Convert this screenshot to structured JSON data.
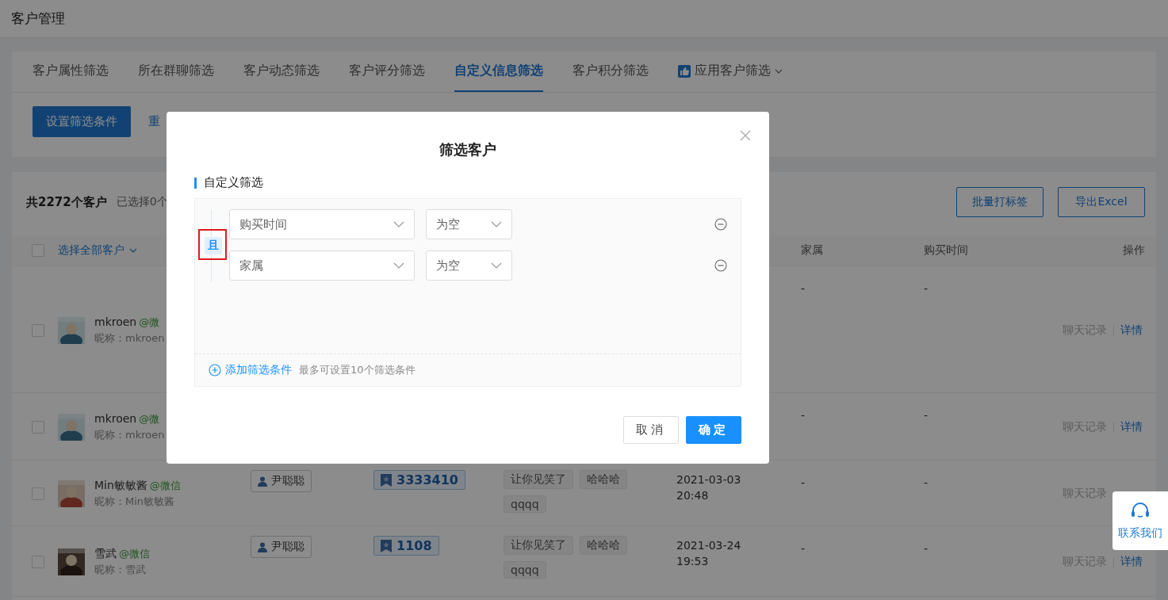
{
  "page": {
    "title": "客户管理"
  },
  "filter_tabs": [
    {
      "label": "客户属性筛选",
      "selected": false,
      "kind": "plain"
    },
    {
      "label": "所在群聊筛选",
      "selected": false,
      "kind": "plain"
    },
    {
      "label": "客户动态筛选",
      "selected": false,
      "kind": "plain"
    },
    {
      "label": "客户评分筛选",
      "selected": false,
      "kind": "plain"
    },
    {
      "label": "自定义信息筛选",
      "selected": true,
      "kind": "plain"
    },
    {
      "label": "客户积分筛选",
      "selected": false,
      "kind": "plain"
    },
    {
      "label": "应用客户筛选",
      "selected": false,
      "kind": "app"
    }
  ],
  "filter_actions": {
    "primary": "设置筛选条件",
    "link": "重"
  },
  "customers": {
    "summary": "共2272个客户",
    "selection": "已选择0个",
    "buttons": [
      "批量打标签",
      "导出Excel"
    ],
    "header": {
      "checked": false,
      "select_all": "选择全部客户",
      "family": "家属",
      "purchase_time": "购买时间",
      "actions": "操作"
    },
    "rows": [
      {
        "checked": false,
        "name": "mkroen",
        "source": "@微",
        "nickname": "昵称：mkroen",
        "family": "-",
        "purchase_time": "-",
        "actions": [
          "聊天记录",
          "详情"
        ]
      },
      {
        "checked": false,
        "name": "mkroen",
        "source": "@微",
        "nickname": "昵称：mkroen",
        "family": "-",
        "purchase_time": "-",
        "actions": [
          "聊天记录",
          "详情"
        ]
      },
      {
        "checked": false,
        "name": "Min敏敏酱",
        "source": "@微信",
        "nickname": "昵称：Min敏敏酱",
        "owner": "尹聪聪",
        "score": "3333410",
        "tags": [
          "让你见笑了",
          "哈哈哈",
          "qqqq"
        ],
        "date": "2021-03-03",
        "time": "20:48",
        "family": "-",
        "purchase_time": "-",
        "actions": [
          "聊天记录"
        ]
      },
      {
        "checked": false,
        "name": "雪武",
        "source": "@微信",
        "nickname": "昵称：雪武",
        "owner": "尹聪聪",
        "score": "1108",
        "tags": [
          "让你见笑了",
          "哈哈哈",
          "qqqq"
        ],
        "date": "2021-03-24",
        "time": "19:53",
        "family": "-",
        "purchase_time": "-",
        "actions": [
          "聊天记录",
          "详情"
        ]
      }
    ]
  },
  "dialog": {
    "title": "筛选客户",
    "section": "自定义筛选",
    "logic": {
      "label": "且",
      "highlighted": true
    },
    "conditions": [
      {
        "field": "购买时间",
        "operator": "为空"
      },
      {
        "field": "家属",
        "operator": "为空"
      }
    ],
    "add_label": "添加筛选条件",
    "hint": "最多可设置10个筛选条件",
    "buttons": [
      {
        "label": "取消",
        "kind": "secondary"
      },
      {
        "label": "确定",
        "kind": "primary"
      }
    ]
  },
  "contact": {
    "label": "联系我们"
  }
}
